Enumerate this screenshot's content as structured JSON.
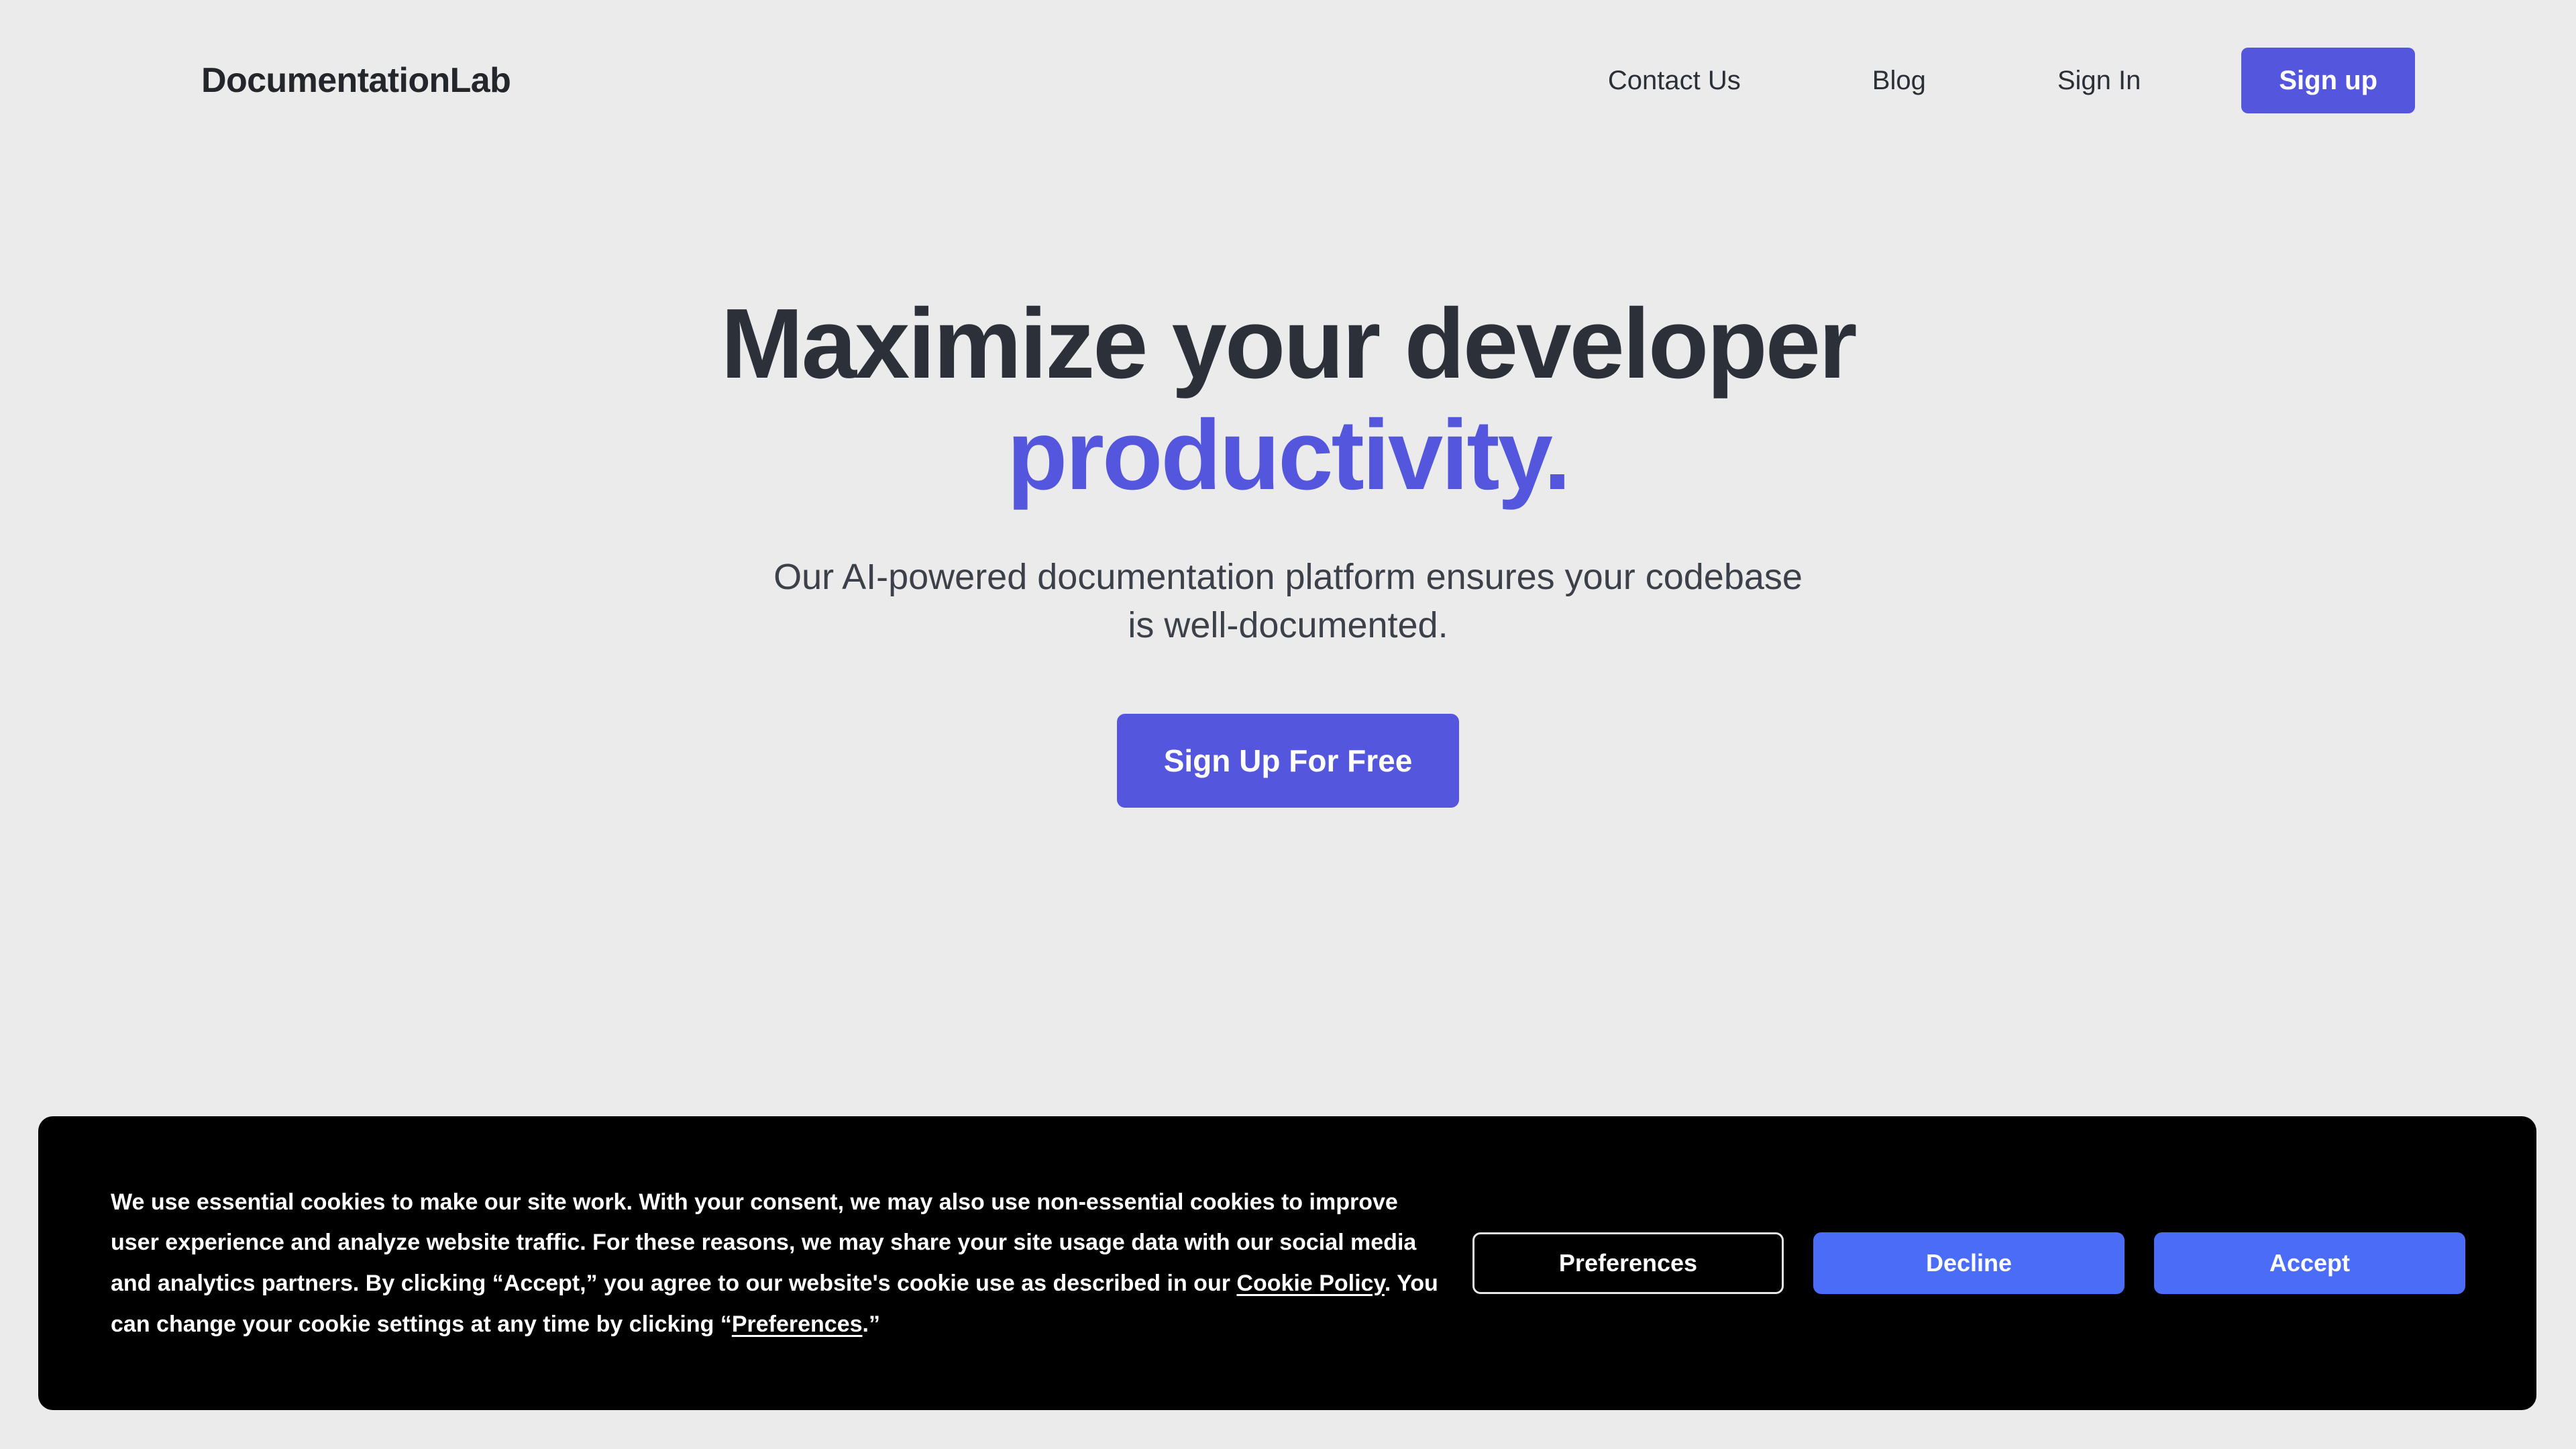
{
  "theme": {
    "page_background": "#ebebec",
    "brand_purple": "#5457de",
    "cookie_button_blue": "#4a6cf7",
    "banner_background": "#000000",
    "heading_color": "#2c3038"
  },
  "header": {
    "brand": "DocumentationLab",
    "nav": [
      {
        "label": "Contact Us",
        "name": "nav-link-contact-us"
      },
      {
        "label": "Blog",
        "name": "nav-link-blog"
      },
      {
        "label": "Sign In",
        "name": "nav-link-sign-in"
      }
    ],
    "signup_label": "Sign up"
  },
  "hero": {
    "title_line1": "Maximize your developer",
    "title_accent": "productivity.",
    "subtitle_line1": "Our AI-powered documentation platform ensures your codebase",
    "subtitle_line2": "is well-documented.",
    "cta_label": "Sign Up For Free"
  },
  "cookie_banner": {
    "text_part1": "We use essential cookies to make our site work. With your consent, we may also use non-essential cookies to improve user experience and analyze website traffic. For these reasons, we may share your site usage data with our social media and analytics partners. By clicking “Accept,” you agree to our website's cookie use as described in our ",
    "link_cookie_policy": "Cookie Policy",
    "text_part2": ". You can change your cookie settings at any time by clicking “",
    "link_preferences": "Preferences",
    "text_part3": ".”",
    "buttons": {
      "preferences": "Preferences",
      "decline": "Decline",
      "accept": "Accept"
    }
  }
}
